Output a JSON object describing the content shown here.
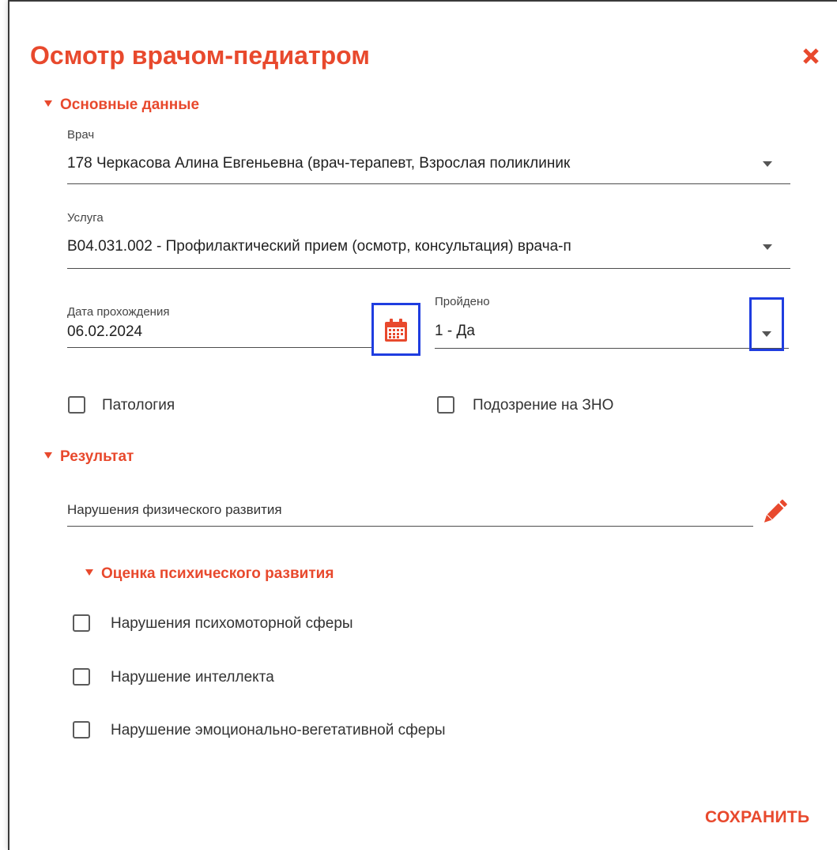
{
  "dialog": {
    "title": "Осмотр врачом-педиатром",
    "accent_color": "#e8492d",
    "highlight_color": "#1f3de0",
    "close_icon": "close-icon"
  },
  "main_section": {
    "header": "Основные данные",
    "doctor": {
      "label": "Врач",
      "value": "178 Черкасова Алина Евгеньевна (врач-терапевт, Взрослая поликлиник"
    },
    "service": {
      "label": "Услуга",
      "value": "B04.031.002 - Профилактический прием (осмотр, консультация) врача-п"
    },
    "date": {
      "label": "Дата прохождения",
      "value": "06.02.2024",
      "icon": "calendar-icon"
    },
    "passed": {
      "label": "Пройдено",
      "value": "1 - Да"
    },
    "checkboxes": [
      {
        "label": "Патология",
        "checked": false
      },
      {
        "label": "Подозрение на ЗНО",
        "checked": false
      }
    ]
  },
  "result_section": {
    "header": "Результат",
    "physical_field": {
      "value": "Нарушения физического развития",
      "icon": "pencil-icon"
    },
    "psych_section": {
      "header": "Оценка психического развития",
      "checkboxes": [
        {
          "label": "Нарушения психомоторной сферы",
          "checked": false
        },
        {
          "label": "Нарушение интеллекта",
          "checked": false
        },
        {
          "label": "Нарушение эмоционально-вегетативной сферы",
          "checked": false
        }
      ]
    }
  },
  "actions": {
    "save_label": "СОХРАНИТЬ"
  }
}
